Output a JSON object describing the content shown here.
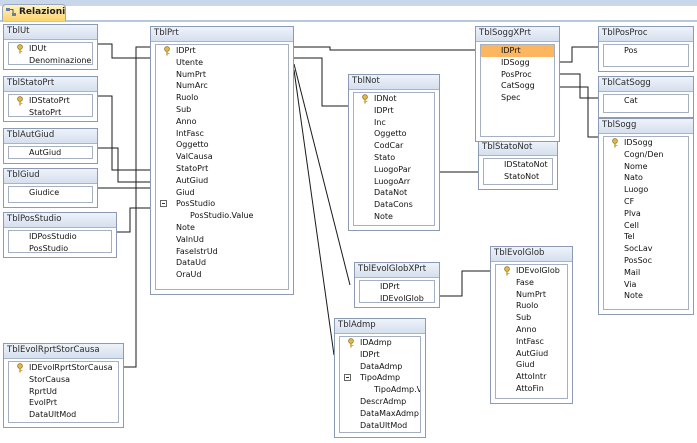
{
  "window": {
    "tab_label": "Relazioni"
  },
  "colors": {
    "selected_row": "#fbb65f",
    "line_color": "#1a1a1a",
    "header_bg": "#dbe5f3"
  },
  "tables": [
    {
      "id": "TblUt",
      "title": "TblUt",
      "fields": [
        {
          "name": "IDUt",
          "key": true
        },
        {
          "name": "Denominazione"
        }
      ]
    },
    {
      "id": "TblStatoPrt",
      "title": "TblStatoPrt",
      "fields": [
        {
          "name": "IDStatoPrt",
          "key": true
        },
        {
          "name": "StatoPrt"
        }
      ]
    },
    {
      "id": "TblAutGiud",
      "title": "TblAutGiud",
      "fields": [
        {
          "name": "AutGiud"
        }
      ]
    },
    {
      "id": "TblGiud",
      "title": "TblGiud",
      "fields": [
        {
          "name": "Giudice"
        }
      ]
    },
    {
      "id": "TblPosStudio",
      "title": "TblPosStudio",
      "fields": [
        {
          "name": "IDPosStudio"
        },
        {
          "name": "PosStudio"
        }
      ]
    },
    {
      "id": "TblEvolRprtStorCausa",
      "title": "TblEvolRprtStorCausa",
      "fields": [
        {
          "name": "IDEvolRprtStorCausa",
          "key": true
        },
        {
          "name": "StorCausa"
        },
        {
          "name": "RprtUd"
        },
        {
          "name": "EvolPrt"
        },
        {
          "name": "DataUltMod"
        }
      ]
    },
    {
      "id": "TblPrt",
      "title": "TblPrt",
      "fields": [
        {
          "name": "IDPrt",
          "key": true
        },
        {
          "name": "Utente"
        },
        {
          "name": "NumPrt"
        },
        {
          "name": "NumArc"
        },
        {
          "name": "Ruolo"
        },
        {
          "name": "Sub"
        },
        {
          "name": "Anno"
        },
        {
          "name": "IntFasc"
        },
        {
          "name": "Oggetto"
        },
        {
          "name": "ValCausa"
        },
        {
          "name": "StatoPrt"
        },
        {
          "name": "AutGiud"
        },
        {
          "name": "Giud"
        },
        {
          "name": "PosStudio",
          "expand": true
        },
        {
          "name": "PosStudio.Value",
          "sub": true
        },
        {
          "name": "Note"
        },
        {
          "name": "ValnUd"
        },
        {
          "name": "FaseIstrUd"
        },
        {
          "name": "DataUd"
        },
        {
          "name": "OraUd"
        }
      ]
    },
    {
      "id": "TblNot",
      "title": "TblNot",
      "fields": [
        {
          "name": "IDNot",
          "key": true
        },
        {
          "name": "IDPrt"
        },
        {
          "name": "Inc"
        },
        {
          "name": "Oggetto"
        },
        {
          "name": "CodCar"
        },
        {
          "name": "Stato"
        },
        {
          "name": "LuogoPar"
        },
        {
          "name": "LuogoArr"
        },
        {
          "name": "DataNot"
        },
        {
          "name": "DataCons"
        },
        {
          "name": "Note"
        }
      ]
    },
    {
      "id": "TblStatoNot",
      "title": "TblStatoNot",
      "fields": [
        {
          "name": "IDStatoNot"
        },
        {
          "name": "StatoNot"
        }
      ]
    },
    {
      "id": "TblEvolGlobXPrt",
      "title": "TblEvolGlobXPrt",
      "fields": [
        {
          "name": "IDPrt"
        },
        {
          "name": "IDEvolGlob"
        }
      ]
    },
    {
      "id": "TblAdmp",
      "title": "TblAdmp",
      "fields": [
        {
          "name": "IDAdmp",
          "key": true
        },
        {
          "name": "IDPrt"
        },
        {
          "name": "DataAdmp"
        },
        {
          "name": "TipoAdmp",
          "expand": true
        },
        {
          "name": "TipoAdmp.Value",
          "sub": true
        },
        {
          "name": "DescrAdmp"
        },
        {
          "name": "DataMaxAdmp"
        },
        {
          "name": "DataUltMod"
        }
      ]
    },
    {
      "id": "TblSoggXPrt",
      "title": "TblSoggXPrt",
      "fields": [
        {
          "name": "IDPrt",
          "selected": true
        },
        {
          "name": "IDSogg"
        },
        {
          "name": "PosProc"
        },
        {
          "name": "CatSogg"
        },
        {
          "name": "Spec"
        }
      ]
    },
    {
      "id": "TblEvolGlob",
      "title": "TblEvolGlob",
      "fields": [
        {
          "name": "IDEvolGlob",
          "key": true
        },
        {
          "name": "Fase"
        },
        {
          "name": "NumPrt"
        },
        {
          "name": "Ruolo"
        },
        {
          "name": "Sub"
        },
        {
          "name": "Anno"
        },
        {
          "name": "IntFasc"
        },
        {
          "name": "AutGiud"
        },
        {
          "name": "Giud"
        },
        {
          "name": "AttoIntr"
        },
        {
          "name": "AttoFin"
        }
      ]
    },
    {
      "id": "TblPosProc",
      "title": "TblPosProc",
      "fields": [
        {
          "name": "Pos"
        }
      ]
    },
    {
      "id": "TblCatSogg",
      "title": "TblCatSogg",
      "fields": [
        {
          "name": "Cat"
        }
      ]
    },
    {
      "id": "TblSogg",
      "title": "TblSogg",
      "fields": [
        {
          "name": "IDSogg",
          "key": true
        },
        {
          "name": "Cogn/Den"
        },
        {
          "name": "Nome"
        },
        {
          "name": "Nato"
        },
        {
          "name": "Luogo"
        },
        {
          "name": "CF"
        },
        {
          "name": "PIva"
        },
        {
          "name": "Cell"
        },
        {
          "name": "Tel"
        },
        {
          "name": "SocLav"
        },
        {
          "name": "PosSoc"
        },
        {
          "name": "Mail"
        },
        {
          "name": "Via"
        },
        {
          "name": "Note"
        }
      ]
    }
  ]
}
